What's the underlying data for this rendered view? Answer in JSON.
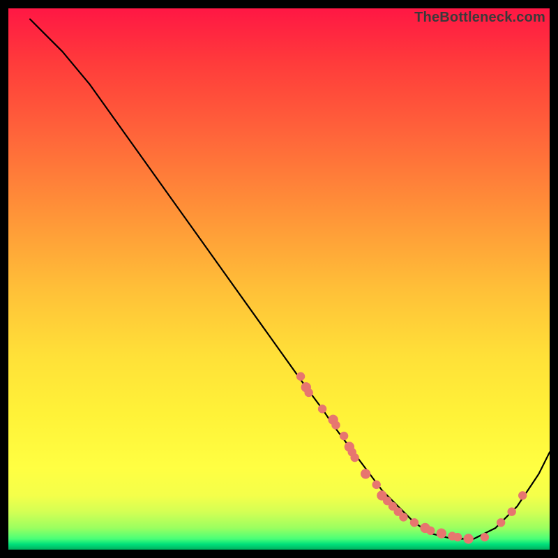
{
  "watermark": "TheBottleneck.com",
  "chart_data": {
    "type": "line",
    "title": "",
    "xlabel": "",
    "ylabel": "",
    "xlim": [
      0,
      100
    ],
    "ylim": [
      0,
      100
    ],
    "grid": false,
    "legend": false,
    "series": [
      {
        "name": "curve",
        "x": [
          4,
          7,
          10,
          15,
          20,
          25,
          30,
          35,
          40,
          45,
          50,
          55,
          58,
          60,
          63,
          66,
          69,
          72,
          75,
          78,
          82,
          86,
          90,
          94,
          98,
          100
        ],
        "y": [
          98,
          95,
          92,
          86,
          79,
          72,
          65,
          58,
          51,
          44,
          37,
          30,
          26,
          23,
          19,
          15,
          11,
          8,
          5,
          3,
          2,
          2,
          4,
          8,
          14,
          18
        ]
      }
    ],
    "scatter": {
      "name": "dots",
      "points": [
        {
          "x": 54,
          "y": 32,
          "r": 6
        },
        {
          "x": 55,
          "y": 30,
          "r": 7
        },
        {
          "x": 55.5,
          "y": 29,
          "r": 6
        },
        {
          "x": 58,
          "y": 26,
          "r": 6
        },
        {
          "x": 60,
          "y": 24,
          "r": 7
        },
        {
          "x": 60.5,
          "y": 23,
          "r": 6
        },
        {
          "x": 62,
          "y": 21,
          "r": 6
        },
        {
          "x": 63,
          "y": 19,
          "r": 7
        },
        {
          "x": 63.5,
          "y": 18,
          "r": 6
        },
        {
          "x": 64,
          "y": 17,
          "r": 6
        },
        {
          "x": 66,
          "y": 14,
          "r": 7
        },
        {
          "x": 68,
          "y": 12,
          "r": 6
        },
        {
          "x": 69,
          "y": 10,
          "r": 7
        },
        {
          "x": 70,
          "y": 9,
          "r": 6
        },
        {
          "x": 71,
          "y": 8,
          "r": 6
        },
        {
          "x": 72,
          "y": 7,
          "r": 6
        },
        {
          "x": 73,
          "y": 6,
          "r": 6
        },
        {
          "x": 75,
          "y": 5,
          "r": 6
        },
        {
          "x": 77,
          "y": 4,
          "r": 7
        },
        {
          "x": 78,
          "y": 3.5,
          "r": 6
        },
        {
          "x": 80,
          "y": 3,
          "r": 7
        },
        {
          "x": 82,
          "y": 2.5,
          "r": 6
        },
        {
          "x": 83,
          "y": 2.3,
          "r": 6
        },
        {
          "x": 85,
          "y": 2,
          "r": 7
        },
        {
          "x": 88,
          "y": 2.3,
          "r": 6
        },
        {
          "x": 91,
          "y": 5,
          "r": 6
        },
        {
          "x": 93,
          "y": 7,
          "r": 6
        },
        {
          "x": 95,
          "y": 10,
          "r": 6
        }
      ]
    }
  }
}
